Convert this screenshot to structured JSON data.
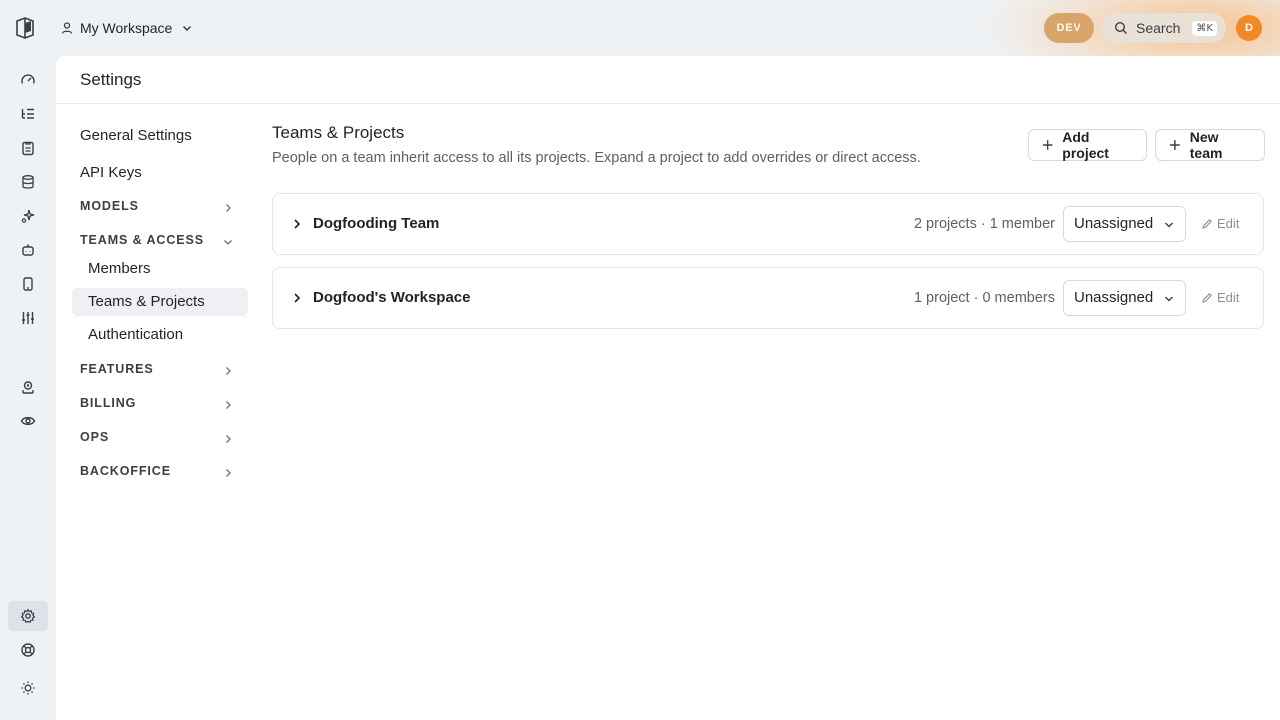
{
  "topbar": {
    "workspace_label": "My Workspace",
    "env_badge": "DEV",
    "search_label": "Search",
    "search_shortcut": "⌘K",
    "avatar_initial": "D",
    "accent_color": "#f08a24"
  },
  "rail": {
    "icons": [
      "gauge-icon",
      "list-tree-icon",
      "clipboard-icon",
      "database-icon",
      "sparkle-icon",
      "bot-icon",
      "phone-icon",
      "sliders-icon",
      "user-badge-icon",
      "eye-icon",
      "gear-icon",
      "lifebuoy-icon",
      "sun-icon"
    ],
    "active": "gear-icon"
  },
  "page": {
    "title": "Settings"
  },
  "nav": {
    "general": "General Settings",
    "api_keys": "API Keys",
    "models": "MODELS",
    "teams_access": "TEAMS & ACCESS",
    "members": "Members",
    "teams_projects": "Teams & Projects",
    "authentication": "Authentication",
    "features": "FEATURES",
    "billing": "BILLING",
    "ops": "OPS",
    "backoffice": "BACKOFFICE"
  },
  "content": {
    "title": "Teams & Projects",
    "description": "People on a team inherit access to all its projects. Expand a project to add overrides or direct access.",
    "add_project": "Add project",
    "new_team": "New team",
    "rows": [
      {
        "name": "Dogfooding Team",
        "meta": "2 projects · 1 member",
        "role": "Unassigned",
        "edit": "Edit"
      },
      {
        "name": "Dogfood's Workspace",
        "meta": "1 project · 0 members",
        "role": "Unassigned",
        "edit": "Edit"
      }
    ]
  }
}
